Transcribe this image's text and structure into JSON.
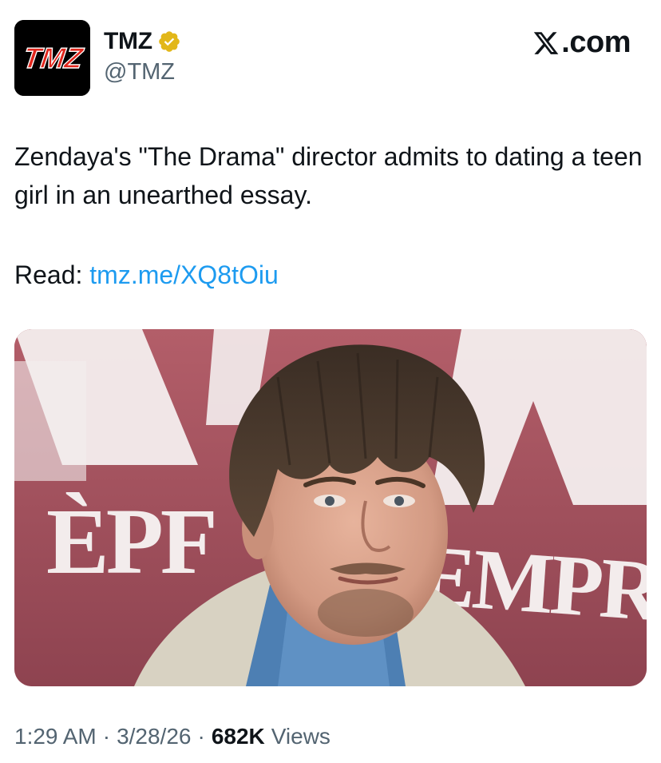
{
  "author": {
    "avatar_text": "TMZ",
    "display_name": "TMZ",
    "handle": "@TMZ",
    "verified_icon": "verified-gold-badge"
  },
  "platform": {
    "logo_icon": "x-logo",
    "label": ".com"
  },
  "tweet": {
    "text": "Zendaya's \"The Drama\" director admits to dating a teen girl in an unearthed essay.",
    "read_label": "Read:",
    "link_text": "tmz.me/XQ8tOiu"
  },
  "media": {
    "backdrop_letters_top": "AMA",
    "backdrop_letters_left": "ÈPF",
    "backdrop_letters_right": "EMPR"
  },
  "footer": {
    "time": "1:29 AM",
    "separator": "·",
    "date": "3/28/26",
    "views_count": "682K",
    "views_label": "Views"
  },
  "colors": {
    "link": "#1d9bf0",
    "secondary_text": "#536471",
    "primary_text": "#0f1419",
    "verified_gold": "#e2b719",
    "tmz_red": "#e1261c",
    "backdrop_red": "#a85560"
  }
}
